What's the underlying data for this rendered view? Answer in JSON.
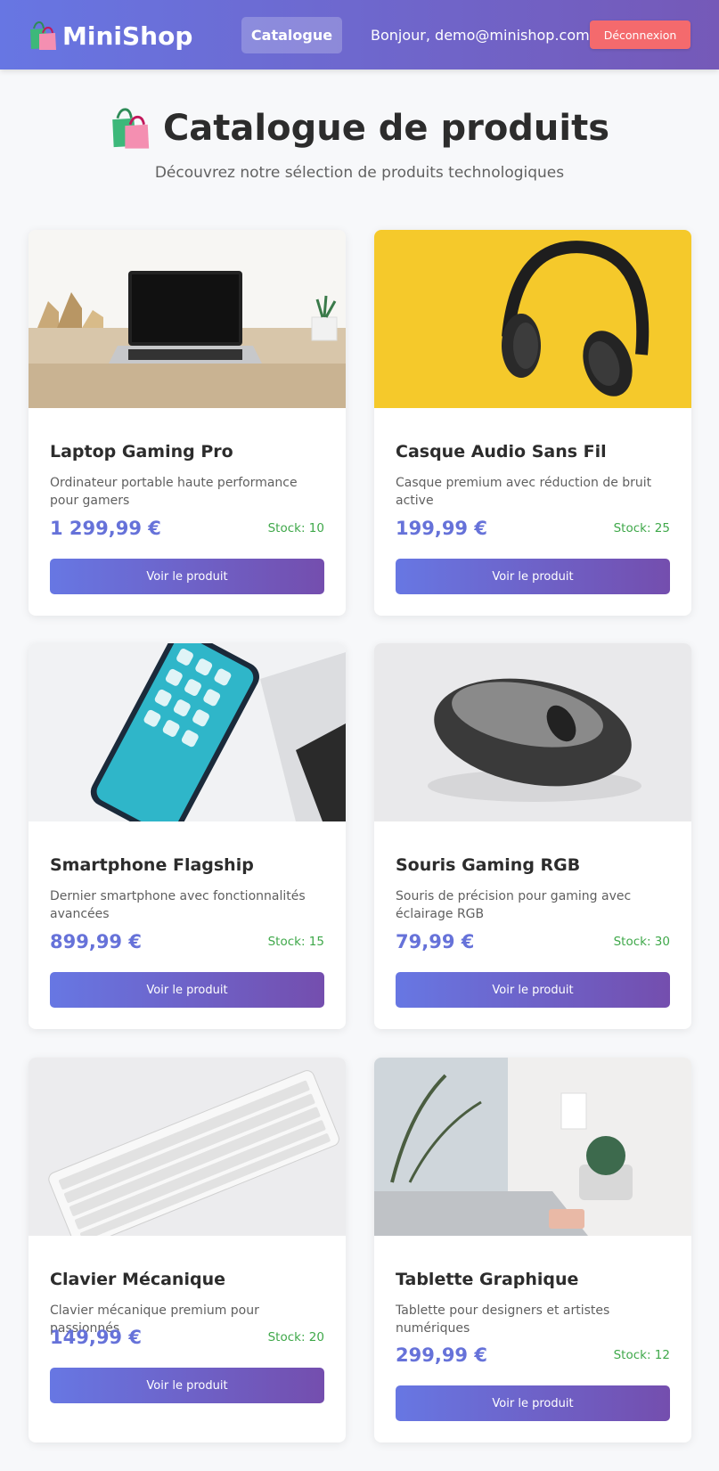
{
  "header": {
    "brand": "MiniShop",
    "nav_catalogue": "Catalogue",
    "greeting": "Bonjour, demo@minishop.com",
    "logout_label": "Déconnexion"
  },
  "page": {
    "title": "Catalogue de produits",
    "subtitle": "Découvrez notre sélection de produits technologiques"
  },
  "products": [
    {
      "name": "Laptop Gaming Pro",
      "description": "Ordinateur portable haute performance pour gamers",
      "price": "1 299,99 €",
      "stock": "Stock: 10",
      "button": "Voir le produit",
      "image": "laptop-photo"
    },
    {
      "name": "Casque Audio Sans Fil",
      "description": "Casque premium avec réduction de bruit active",
      "price": "199,99 €",
      "stock": "Stock: 25",
      "button": "Voir le produit",
      "image": "headphones-photo"
    },
    {
      "name": "Smartphone Flagship",
      "description": "Dernier smartphone avec fonctionnalités avancées",
      "price": "899,99 €",
      "stock": "Stock: 15",
      "button": "Voir le produit",
      "image": "smartphone-photo"
    },
    {
      "name": "Souris Gaming RGB",
      "description": "Souris de précision pour gaming avec éclairage RGB",
      "price": "79,99 €",
      "stock": "Stock: 30",
      "button": "Voir le produit",
      "image": "mouse-photo"
    },
    {
      "name": "Clavier Mécanique",
      "description": "Clavier mécanique premium pour passionnés",
      "price": "149,99 €",
      "stock": "Stock: 20",
      "button": "Voir le produit",
      "image": "keyboard-photo"
    },
    {
      "name": "Tablette Graphique",
      "description": "Tablette pour designers et artistes numériques",
      "price": "299,99 €",
      "stock": "Stock: 12",
      "button": "Voir le produit",
      "image": "tablet-photo"
    }
  ],
  "colors": {
    "header_gradient_start": "#6776e3",
    "header_gradient_end": "#7559b8",
    "logout": "#f46a6d",
    "price": "#6672d9",
    "stock": "#3fa84a",
    "button_gradient_start": "#6777e3",
    "button_gradient_end": "#744eae"
  },
  "icons": {
    "brand": "shopping-bags-icon",
    "title": "shopping-bags-icon"
  }
}
